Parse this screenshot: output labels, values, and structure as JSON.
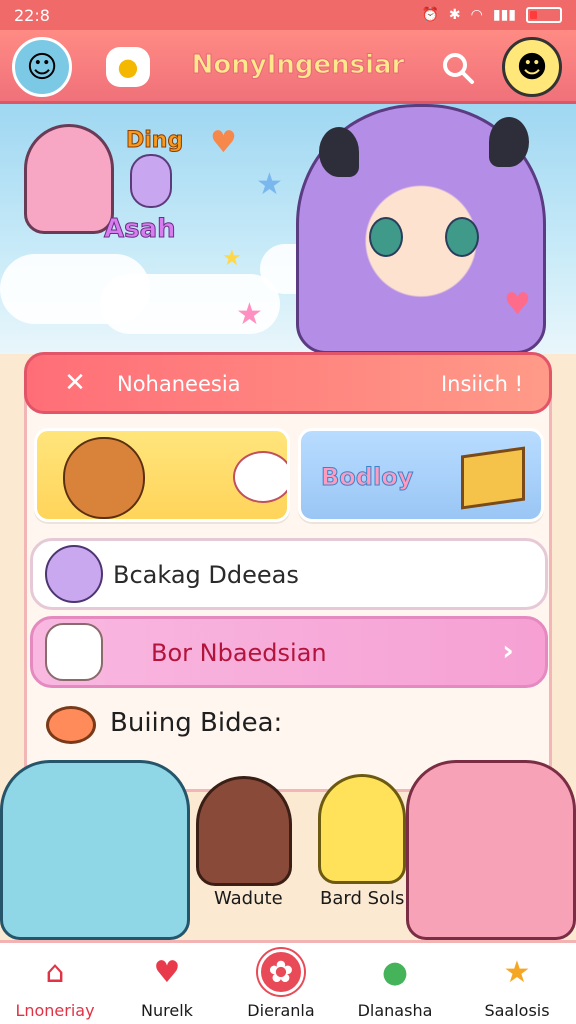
{
  "status_bar": {
    "time": "22:8",
    "battery_level": 0.25
  },
  "header": {
    "title": "NonyIngensiar",
    "left_avatar_icon": "anime-girl-avatar-icon",
    "mascot_icon": "chick-icon",
    "search_icon": "search-icon",
    "right_avatar_icon": "profile-avatar-icon"
  },
  "hero": {
    "badge_text": "Ding",
    "caption": "Asah"
  },
  "search": {
    "value": "Nohaneesia",
    "action_label": "Insiich !"
  },
  "tiles": [
    {
      "label": "",
      "icon": "bunny-icon"
    },
    {
      "label": "Bodloy",
      "icon": "box-icon"
    }
  ],
  "rows": [
    {
      "label": "Bcakag Ddeeas"
    },
    {
      "label": "Bor Nbaedsian"
    }
  ],
  "section": {
    "title": "Buiing Bidea:"
  },
  "characters": [
    {
      "name": ""
    },
    {
      "name": "Wadute"
    },
    {
      "name": "Bard Sols"
    },
    {
      "name": ""
    }
  ],
  "bottom_nav": [
    {
      "label": "Lnoneriay",
      "icon": "home-icon"
    },
    {
      "label": "Nurelk",
      "icon": "heart-icon"
    },
    {
      "label": "Dieranla",
      "icon": "bunny-badge-icon"
    },
    {
      "label": "Dlanasha",
      "icon": "frog-icon"
    },
    {
      "label": "Saalosis",
      "icon": "star-icon"
    }
  ],
  "colors": {
    "header": "#f0717a",
    "accent_pink": "#f6a0d4",
    "accent_yellow": "#ffd45a",
    "accent_blue": "#9ac6f5"
  }
}
